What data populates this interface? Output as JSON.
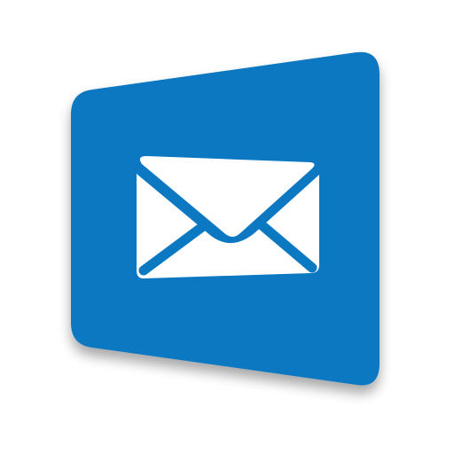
{
  "app_icon": {
    "icon_name": "mail-app-icon",
    "glyph_name": "envelope-icon",
    "colors": {
      "tile": "#0B78C2",
      "tile_shadow": "#6f8fa8",
      "envelope": "#ffffff",
      "background": "#ffffff"
    }
  }
}
